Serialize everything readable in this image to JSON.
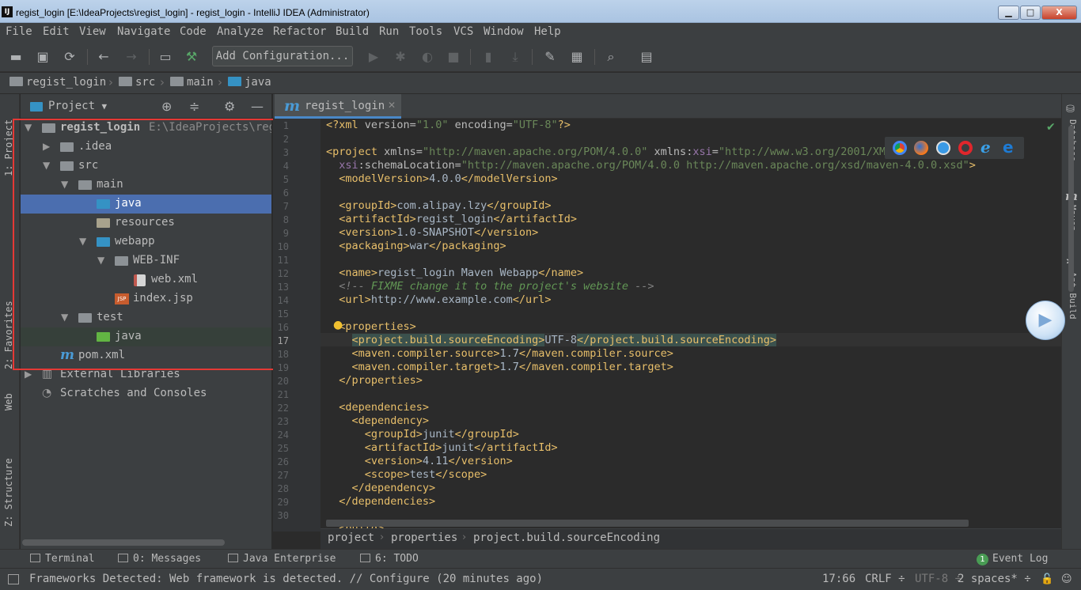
{
  "window": {
    "title": "regist_login [E:\\IdeaProjects\\regist_login] - regist_login - IntelliJ IDEA (Administrator)",
    "app_icon": "IJ",
    "minimize": "▁",
    "maximize": "□",
    "close": "X"
  },
  "menu": [
    "File",
    "Edit",
    "View",
    "Navigate",
    "Code",
    "Analyze",
    "Refactor",
    "Build",
    "Run",
    "Tools",
    "VCS",
    "Window",
    "Help"
  ],
  "toolbar": {
    "add_configuration": "Add Configuration..."
  },
  "navbar": {
    "items": [
      "regist_login",
      "src",
      "main",
      "java"
    ]
  },
  "left_stripe": {
    "project": "1: Project",
    "favorites": "2: Favorites",
    "web": "Web",
    "structure": "Z: Structure"
  },
  "project": {
    "header": "Project",
    "tree": [
      {
        "label": "regist_login",
        "path": "E:\\IdeaProjects\\regi"
      },
      {
        "label": ".idea"
      },
      {
        "label": "src"
      },
      {
        "label": "main"
      },
      {
        "label": "java"
      },
      {
        "label": "resources"
      },
      {
        "label": "webapp"
      },
      {
        "label": "WEB-INF"
      },
      {
        "label": "web.xml"
      },
      {
        "label": "index.jsp"
      },
      {
        "label": "test"
      },
      {
        "label": "java"
      },
      {
        "label": "pom.xml"
      },
      {
        "label": "External Libraries"
      },
      {
        "label": "Scratches and Consoles"
      }
    ]
  },
  "editor": {
    "tab": {
      "label": "regist_login",
      "icon": "m"
    },
    "lines": [
      "1",
      "2",
      "3",
      "4",
      "5",
      "6",
      "7",
      "8",
      "9",
      "10",
      "11",
      "12",
      "13",
      "14",
      "15",
      "16",
      "17",
      "18",
      "19",
      "20",
      "21",
      "22",
      "23",
      "24",
      "25",
      "26",
      "27",
      "28",
      "29",
      "30"
    ],
    "breadcrumb": [
      "project",
      "properties",
      "project.build.sourceEncoding"
    ]
  },
  "right_stripe": {
    "database": "Database",
    "maven": "Maven",
    "ant": "Ant Build"
  },
  "bottom_tools": {
    "terminal": "Terminal",
    "messages": "0: Messages",
    "java_enterprise": "Java Enterprise",
    "todo": "6: TODO",
    "event_log": "Event Log",
    "event_count": "1"
  },
  "status": {
    "message": "Frameworks Detected: Web framework is detected. // Configure (20 minutes ago)",
    "position": "17:66",
    "line_sep": "CRLF ÷",
    "encoding": "UTF-8 ÷",
    "indent": "2 spaces* ÷"
  },
  "colors": {
    "selection": "#4b6eaf",
    "annotation_border": "#e53935",
    "accent": "#4a88c7"
  }
}
